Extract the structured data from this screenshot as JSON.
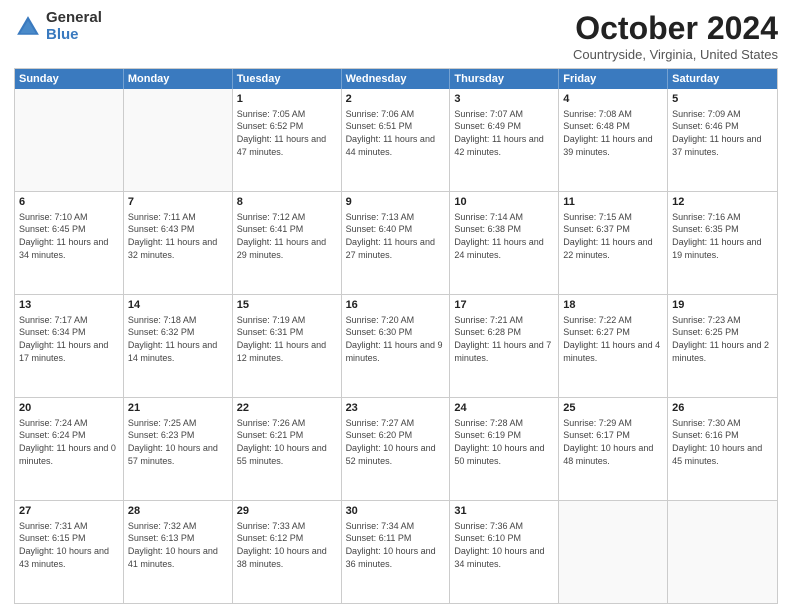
{
  "header": {
    "logo_general": "General",
    "logo_blue": "Blue",
    "month_title": "October 2024",
    "location": "Countryside, Virginia, United States"
  },
  "calendar": {
    "days_of_week": [
      "Sunday",
      "Monday",
      "Tuesday",
      "Wednesday",
      "Thursday",
      "Friday",
      "Saturday"
    ],
    "rows": [
      [
        {
          "day": "",
          "sunrise": "",
          "sunset": "",
          "daylight": ""
        },
        {
          "day": "",
          "sunrise": "",
          "sunset": "",
          "daylight": ""
        },
        {
          "day": "1",
          "sunrise": "Sunrise: 7:05 AM",
          "sunset": "Sunset: 6:52 PM",
          "daylight": "Daylight: 11 hours and 47 minutes."
        },
        {
          "day": "2",
          "sunrise": "Sunrise: 7:06 AM",
          "sunset": "Sunset: 6:51 PM",
          "daylight": "Daylight: 11 hours and 44 minutes."
        },
        {
          "day": "3",
          "sunrise": "Sunrise: 7:07 AM",
          "sunset": "Sunset: 6:49 PM",
          "daylight": "Daylight: 11 hours and 42 minutes."
        },
        {
          "day": "4",
          "sunrise": "Sunrise: 7:08 AM",
          "sunset": "Sunset: 6:48 PM",
          "daylight": "Daylight: 11 hours and 39 minutes."
        },
        {
          "day": "5",
          "sunrise": "Sunrise: 7:09 AM",
          "sunset": "Sunset: 6:46 PM",
          "daylight": "Daylight: 11 hours and 37 minutes."
        }
      ],
      [
        {
          "day": "6",
          "sunrise": "Sunrise: 7:10 AM",
          "sunset": "Sunset: 6:45 PM",
          "daylight": "Daylight: 11 hours and 34 minutes."
        },
        {
          "day": "7",
          "sunrise": "Sunrise: 7:11 AM",
          "sunset": "Sunset: 6:43 PM",
          "daylight": "Daylight: 11 hours and 32 minutes."
        },
        {
          "day": "8",
          "sunrise": "Sunrise: 7:12 AM",
          "sunset": "Sunset: 6:41 PM",
          "daylight": "Daylight: 11 hours and 29 minutes."
        },
        {
          "day": "9",
          "sunrise": "Sunrise: 7:13 AM",
          "sunset": "Sunset: 6:40 PM",
          "daylight": "Daylight: 11 hours and 27 minutes."
        },
        {
          "day": "10",
          "sunrise": "Sunrise: 7:14 AM",
          "sunset": "Sunset: 6:38 PM",
          "daylight": "Daylight: 11 hours and 24 minutes."
        },
        {
          "day": "11",
          "sunrise": "Sunrise: 7:15 AM",
          "sunset": "Sunset: 6:37 PM",
          "daylight": "Daylight: 11 hours and 22 minutes."
        },
        {
          "day": "12",
          "sunrise": "Sunrise: 7:16 AM",
          "sunset": "Sunset: 6:35 PM",
          "daylight": "Daylight: 11 hours and 19 minutes."
        }
      ],
      [
        {
          "day": "13",
          "sunrise": "Sunrise: 7:17 AM",
          "sunset": "Sunset: 6:34 PM",
          "daylight": "Daylight: 11 hours and 17 minutes."
        },
        {
          "day": "14",
          "sunrise": "Sunrise: 7:18 AM",
          "sunset": "Sunset: 6:32 PM",
          "daylight": "Daylight: 11 hours and 14 minutes."
        },
        {
          "day": "15",
          "sunrise": "Sunrise: 7:19 AM",
          "sunset": "Sunset: 6:31 PM",
          "daylight": "Daylight: 11 hours and 12 minutes."
        },
        {
          "day": "16",
          "sunrise": "Sunrise: 7:20 AM",
          "sunset": "Sunset: 6:30 PM",
          "daylight": "Daylight: 11 hours and 9 minutes."
        },
        {
          "day": "17",
          "sunrise": "Sunrise: 7:21 AM",
          "sunset": "Sunset: 6:28 PM",
          "daylight": "Daylight: 11 hours and 7 minutes."
        },
        {
          "day": "18",
          "sunrise": "Sunrise: 7:22 AM",
          "sunset": "Sunset: 6:27 PM",
          "daylight": "Daylight: 11 hours and 4 minutes."
        },
        {
          "day": "19",
          "sunrise": "Sunrise: 7:23 AM",
          "sunset": "Sunset: 6:25 PM",
          "daylight": "Daylight: 11 hours and 2 minutes."
        }
      ],
      [
        {
          "day": "20",
          "sunrise": "Sunrise: 7:24 AM",
          "sunset": "Sunset: 6:24 PM",
          "daylight": "Daylight: 11 hours and 0 minutes."
        },
        {
          "day": "21",
          "sunrise": "Sunrise: 7:25 AM",
          "sunset": "Sunset: 6:23 PM",
          "daylight": "Daylight: 10 hours and 57 minutes."
        },
        {
          "day": "22",
          "sunrise": "Sunrise: 7:26 AM",
          "sunset": "Sunset: 6:21 PM",
          "daylight": "Daylight: 10 hours and 55 minutes."
        },
        {
          "day": "23",
          "sunrise": "Sunrise: 7:27 AM",
          "sunset": "Sunset: 6:20 PM",
          "daylight": "Daylight: 10 hours and 52 minutes."
        },
        {
          "day": "24",
          "sunrise": "Sunrise: 7:28 AM",
          "sunset": "Sunset: 6:19 PM",
          "daylight": "Daylight: 10 hours and 50 minutes."
        },
        {
          "day": "25",
          "sunrise": "Sunrise: 7:29 AM",
          "sunset": "Sunset: 6:17 PM",
          "daylight": "Daylight: 10 hours and 48 minutes."
        },
        {
          "day": "26",
          "sunrise": "Sunrise: 7:30 AM",
          "sunset": "Sunset: 6:16 PM",
          "daylight": "Daylight: 10 hours and 45 minutes."
        }
      ],
      [
        {
          "day": "27",
          "sunrise": "Sunrise: 7:31 AM",
          "sunset": "Sunset: 6:15 PM",
          "daylight": "Daylight: 10 hours and 43 minutes."
        },
        {
          "day": "28",
          "sunrise": "Sunrise: 7:32 AM",
          "sunset": "Sunset: 6:13 PM",
          "daylight": "Daylight: 10 hours and 41 minutes."
        },
        {
          "day": "29",
          "sunrise": "Sunrise: 7:33 AM",
          "sunset": "Sunset: 6:12 PM",
          "daylight": "Daylight: 10 hours and 38 minutes."
        },
        {
          "day": "30",
          "sunrise": "Sunrise: 7:34 AM",
          "sunset": "Sunset: 6:11 PM",
          "daylight": "Daylight: 10 hours and 36 minutes."
        },
        {
          "day": "31",
          "sunrise": "Sunrise: 7:36 AM",
          "sunset": "Sunset: 6:10 PM",
          "daylight": "Daylight: 10 hours and 34 minutes."
        },
        {
          "day": "",
          "sunrise": "",
          "sunset": "",
          "daylight": ""
        },
        {
          "day": "",
          "sunrise": "",
          "sunset": "",
          "daylight": ""
        }
      ]
    ]
  }
}
